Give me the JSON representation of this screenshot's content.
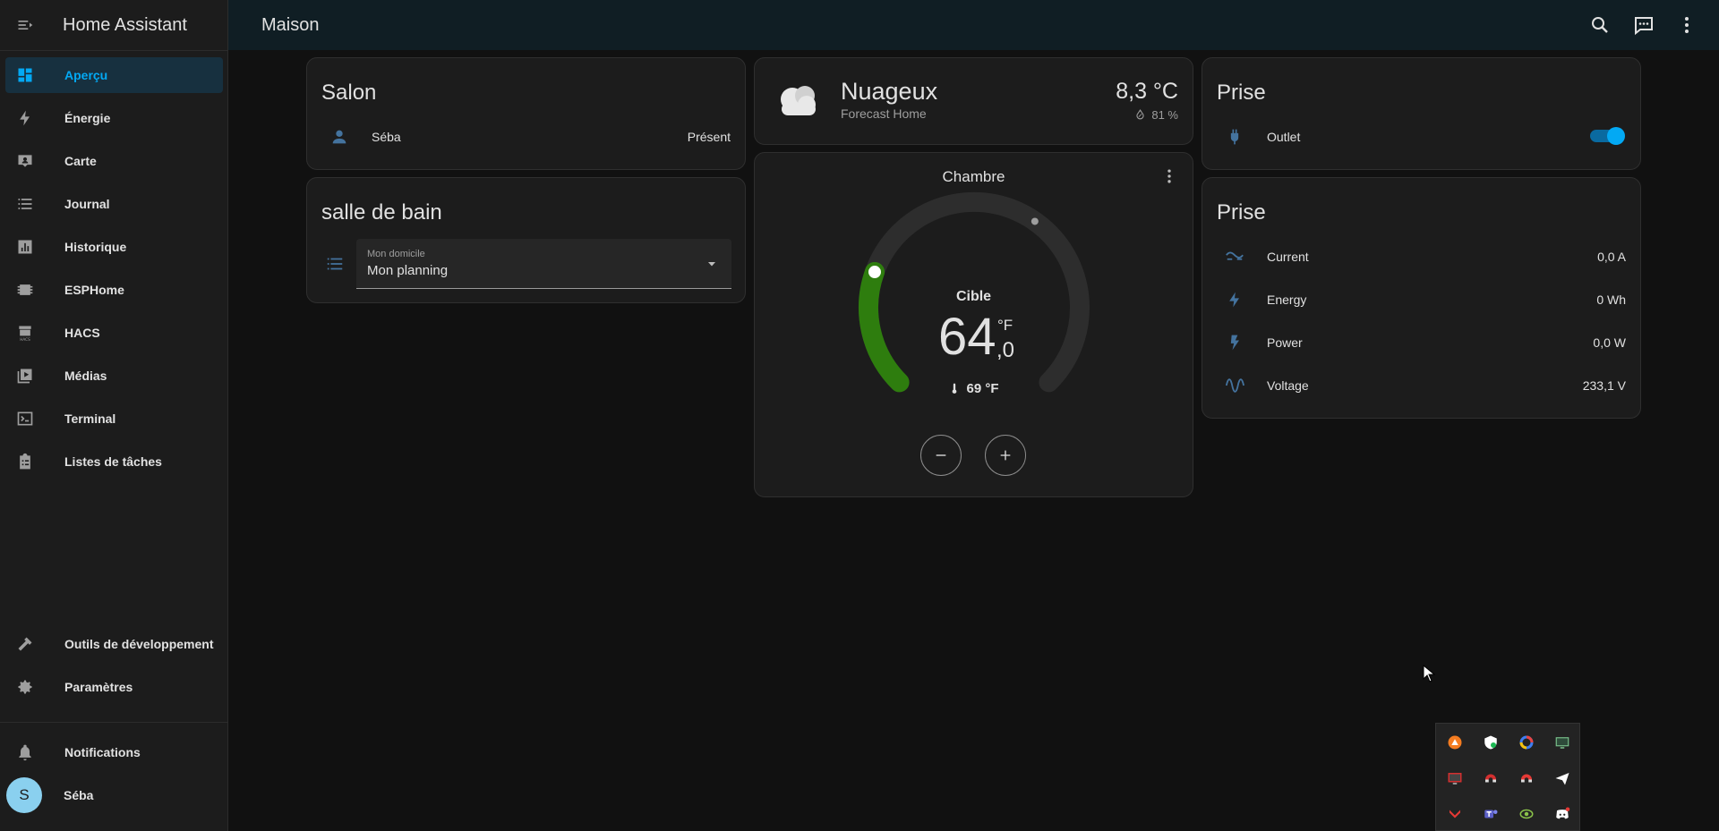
{
  "app": {
    "title": "Home Assistant"
  },
  "sidebar": {
    "items": [
      {
        "label": "Aperçu",
        "icon": "dashboard-icon",
        "active": true
      },
      {
        "label": "Énergie",
        "icon": "lightning-icon"
      },
      {
        "label": "Carte",
        "icon": "map-icon"
      },
      {
        "label": "Journal",
        "icon": "list-icon"
      },
      {
        "label": "Historique",
        "icon": "chart-icon"
      },
      {
        "label": "ESPHome",
        "icon": "chip-icon"
      },
      {
        "label": "HACS",
        "icon": "hacs-icon"
      },
      {
        "label": "Médias",
        "icon": "media-icon"
      },
      {
        "label": "Terminal",
        "icon": "terminal-icon"
      },
      {
        "label": "Listes de tâches",
        "icon": "clipboard-list-icon"
      }
    ],
    "bottom": [
      {
        "label": "Outils de développement",
        "icon": "hammer-icon"
      },
      {
        "label": "Paramètres",
        "icon": "gear-icon"
      }
    ],
    "notifications_label": "Notifications",
    "user": {
      "initial": "S",
      "name": "Séba"
    }
  },
  "header": {
    "title": "Maison"
  },
  "cards": {
    "salon": {
      "title": "Salon",
      "person": {
        "name": "Séba",
        "state": "Présent"
      }
    },
    "salle_de_bain": {
      "title": "salle de bain",
      "select": {
        "label": "Mon domicile",
        "value": "Mon planning"
      }
    },
    "weather": {
      "condition": "Nuageux",
      "source": "Forecast Home",
      "temperature": "8,3 °C",
      "humidity": "81 %"
    },
    "thermostat": {
      "name": "Chambre",
      "mode_label": "Cible",
      "target_int": "64",
      "target_dec": ",0",
      "unit": "°F",
      "current": "69 °F",
      "target_fraction": 0.24,
      "current_fraction": 0.63
    },
    "prise1": {
      "title": "Prise",
      "outlet": {
        "name": "Outlet",
        "on": true
      }
    },
    "prise2": {
      "title": "Prise",
      "rows": [
        {
          "name": "Current",
          "value": "0,0 A",
          "icon": "current-ac-icon"
        },
        {
          "name": "Energy",
          "value": "0 Wh",
          "icon": "lightning-icon"
        },
        {
          "name": "Power",
          "value": "0,0 W",
          "icon": "flash-icon"
        },
        {
          "name": "Voltage",
          "value": "233,1 V",
          "icon": "sine-wave-icon"
        }
      ]
    }
  },
  "colors": {
    "accent": "#03a9f4",
    "heat": "#2e7d0e",
    "background": "#111111",
    "card": "#1c1c1c"
  }
}
